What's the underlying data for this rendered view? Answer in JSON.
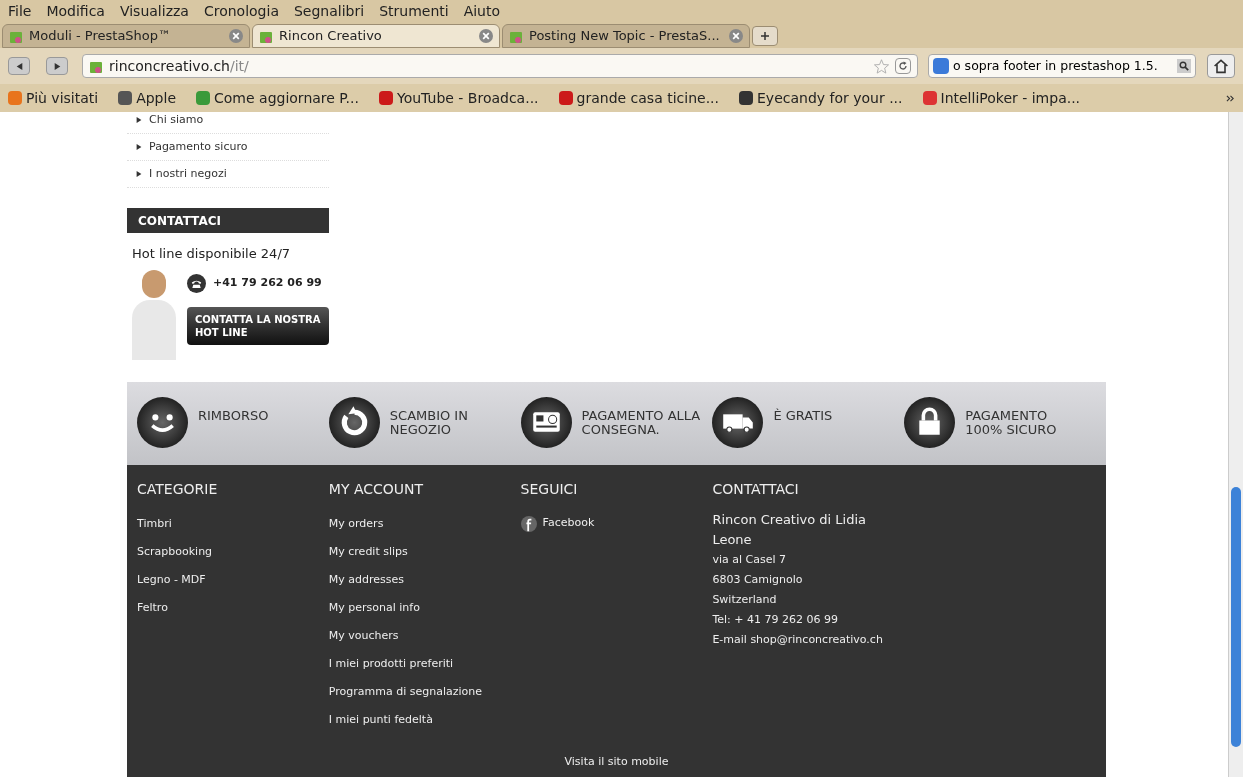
{
  "menu_bar": [
    "File",
    "Modifica",
    "Visualizza",
    "Cronologia",
    "Segnalibri",
    "Strumenti",
    "Aiuto"
  ],
  "tabs": [
    {
      "label": "Moduli - PrestaShop™",
      "selected": false
    },
    {
      "label": "Rincon Creativo",
      "selected": true
    },
    {
      "label": "Posting New Topic - PrestaS...",
      "selected": false
    }
  ],
  "address_bar": {
    "host": "rinconcreativo.ch",
    "path": "/it/"
  },
  "search_bar": {
    "value": "o sopra footer in prestashop 1.5."
  },
  "bookmarks": [
    {
      "label": "Più visitati"
    },
    {
      "label": "Apple"
    },
    {
      "label": "Come aggiornare P..."
    },
    {
      "label": "YouTube - Broadca..."
    },
    {
      "label": "grande casa ticine..."
    },
    {
      "label": "Eyecandy for your ..."
    },
    {
      "label": "IntelliPoker - impa..."
    }
  ],
  "sidebar": {
    "links": [
      "Chi siamo",
      "Pagamento sicuro",
      "I nostri negozi"
    ],
    "contact": {
      "title": "CONTATTACI",
      "hotline": "Hot line disponibile 24/7",
      "phone": "+41 79 262 06 99",
      "button": "CONTATTA LA NOSTRA HOT LINE"
    }
  },
  "features": [
    "RIMBORSO",
    "SCAMBIO IN NEGOZIO",
    "PAGAMENTO ALLA CONSEGNA.",
    "È GRATIS",
    "PAGAMENTO 100% SICURO"
  ],
  "footer": {
    "categories": {
      "title": "CATEGORIE",
      "links": [
        "Timbri",
        "Scrapbooking",
        "Legno - MDF",
        "Feltro"
      ]
    },
    "account": {
      "title": "MY ACCOUNT",
      "links": [
        "My orders",
        "My credit slips",
        "My addresses",
        "My personal info",
        "My vouchers",
        "I miei prodotti preferiti",
        "Programma di segnalazione",
        "I miei punti fedeltà"
      ]
    },
    "follow": {
      "title": "SEGUICI",
      "links": [
        "Facebook"
      ]
    },
    "contact": {
      "title": "CONTATTACI",
      "name": "Rincon Creativo di Lidia Leone",
      "lines": [
        "via al Casel 7",
        "6803 Camignolo",
        "Switzerland",
        "Tel: + 41 79 262 06 99",
        "E-mail shop@rinconcreativo.ch"
      ]
    },
    "mobile_link": "Visita il sito mobile"
  }
}
